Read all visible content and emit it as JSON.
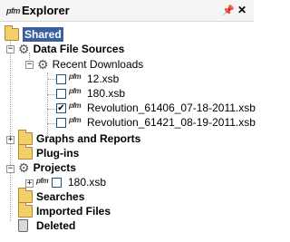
{
  "header": {
    "app_logo": "pfm",
    "title": "Explorer",
    "pin_icon": "pin-icon",
    "close_icon": "close-icon"
  },
  "tree": {
    "shared": "Shared",
    "data_file_sources": "Data File Sources",
    "recent_downloads": "Recent Downloads",
    "files": [
      {
        "name": "12.xsb",
        "checked": false
      },
      {
        "name": "180.xsb",
        "checked": false
      },
      {
        "name": "Revolution_61406_07-18-2011.xsb",
        "checked": true
      },
      {
        "name": "Revolution_61421_08-19-2011.xsb",
        "checked": false
      }
    ],
    "graphs_and_reports": "Graphs and Reports",
    "plugins": "Plug-ins",
    "projects": "Projects",
    "project_file": "180.xsb",
    "searches": "Searches",
    "imported_files": "Imported Files",
    "deleted": "Deleted"
  },
  "colors": {
    "selection": "#3a5f9c",
    "folder": "#f2cf6a"
  }
}
